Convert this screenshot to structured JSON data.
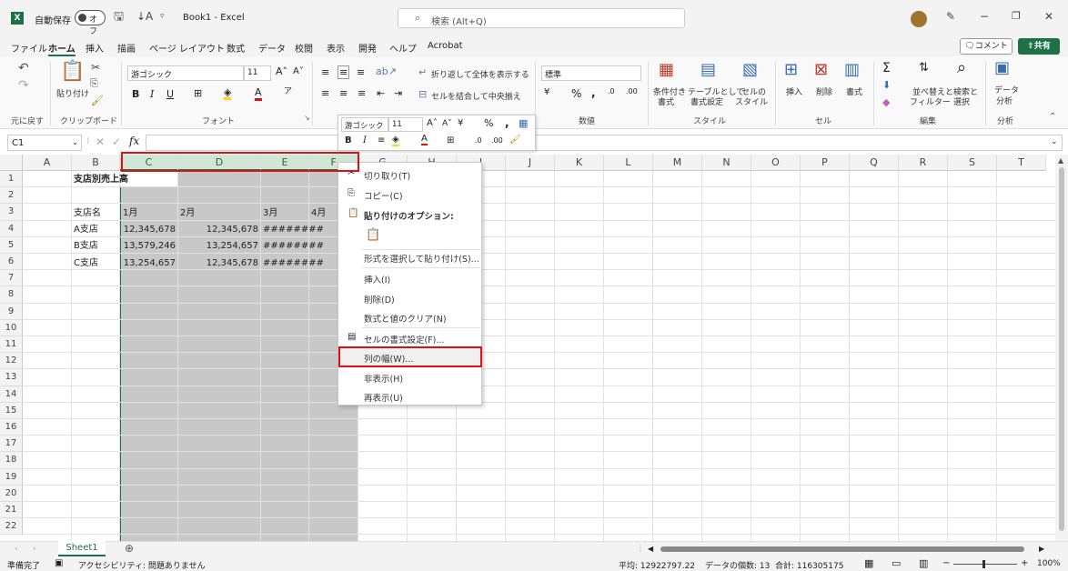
{
  "window": {
    "autosave_label": "自動保存",
    "autosave_state": "オフ",
    "title": "Book1 - Excel",
    "search_placeholder": "検索 (Alt+Q)"
  },
  "menu": [
    "ファイル",
    "ホーム",
    "挿入",
    "描画",
    "ページ レイアウト",
    "数式",
    "データ",
    "校閲",
    "表示",
    "開発",
    "ヘルプ",
    "Acrobat"
  ],
  "menu_active": "ホーム",
  "comment_label": "コメント",
  "share_label": "共有",
  "ribbon": {
    "undo_label": "元に戻す",
    "clipboard_label": "クリップボード",
    "paste_label": "貼り付け",
    "font_name": "游ゴシック",
    "font_size": "11",
    "font_label": "フォント",
    "wrap_text": "折り返して全体を表示する",
    "merge_center": "セルを結合して中央揃え",
    "number_format": "標準",
    "number_label": "数値",
    "cond_format": "条件付き",
    "cond_format2": "書式",
    "table_format": "テーブルとして",
    "table_format2": "書式設定",
    "cell_style": "セルの",
    "cell_style2": "スタイル",
    "style_label": "スタイル",
    "insert": "挿入",
    "delete": "削除",
    "format": "書式",
    "cells_label": "セル",
    "sort_filter": "並べ替えと",
    "sort_filter2": "フィルター",
    "find_select": "検索と",
    "find_select2": "選択",
    "edit_label": "編集",
    "analyze": "データ",
    "analyze2": "分析",
    "analysis_label": "分析"
  },
  "namebox": "C1",
  "columns": [
    "A",
    "B",
    "C",
    "D",
    "E",
    "F",
    "G",
    "H",
    "I",
    "J",
    "K",
    "L",
    "M",
    "N",
    "O",
    "P",
    "Q",
    "R",
    "S",
    "T"
  ],
  "rows": [
    "1",
    "2",
    "3",
    "4",
    "5",
    "6",
    "7",
    "8",
    "9",
    "10",
    "11",
    "12",
    "13",
    "14",
    "15",
    "16",
    "17",
    "18",
    "19",
    "20",
    "21",
    "22"
  ],
  "cells": {
    "b1": "支店別売上高",
    "b3": "支店名",
    "c3": "1月",
    "d3": "2月",
    "e3": "3月",
    "f3": "4月",
    "b4": "A支店",
    "c4": "12,345,678",
    "d4": "12,345,678",
    "e4": "########",
    "b5": "B支店",
    "c5": "13,579,246",
    "d5": "13,254,657",
    "e5": "########",
    "b6": "C支店",
    "c6": "13,254,657",
    "d6": "12,345,678",
    "e6": "########"
  },
  "mini_toolbar": {
    "font": "游ゴシック",
    "size": "11"
  },
  "context_menu": {
    "cut": "切り取り(T)",
    "copy": "コピー(C)",
    "paste_options": "貼り付けのオプション:",
    "paste_special": "形式を選択して貼り付け(S)...",
    "insert": "挿入(I)",
    "delete": "削除(D)",
    "clear": "数式と値のクリア(N)",
    "format_cells": "セルの書式設定(F)...",
    "column_width": "列の幅(W)...",
    "hide": "非表示(H)",
    "unhide": "再表示(U)"
  },
  "sheet_tab": "Sheet1",
  "status": {
    "ready": "準備完了",
    "accessibility": "アクセシビリティ: 問題ありません",
    "average": "平均: 12922797.22",
    "count": "データの個数: 13",
    "sum": "合計: 116305175",
    "zoom": "100%"
  },
  "colors": {
    "excel_green": "#1e7145",
    "highlight_red": "#e01010",
    "selection_gray": "#c8c8c8"
  }
}
